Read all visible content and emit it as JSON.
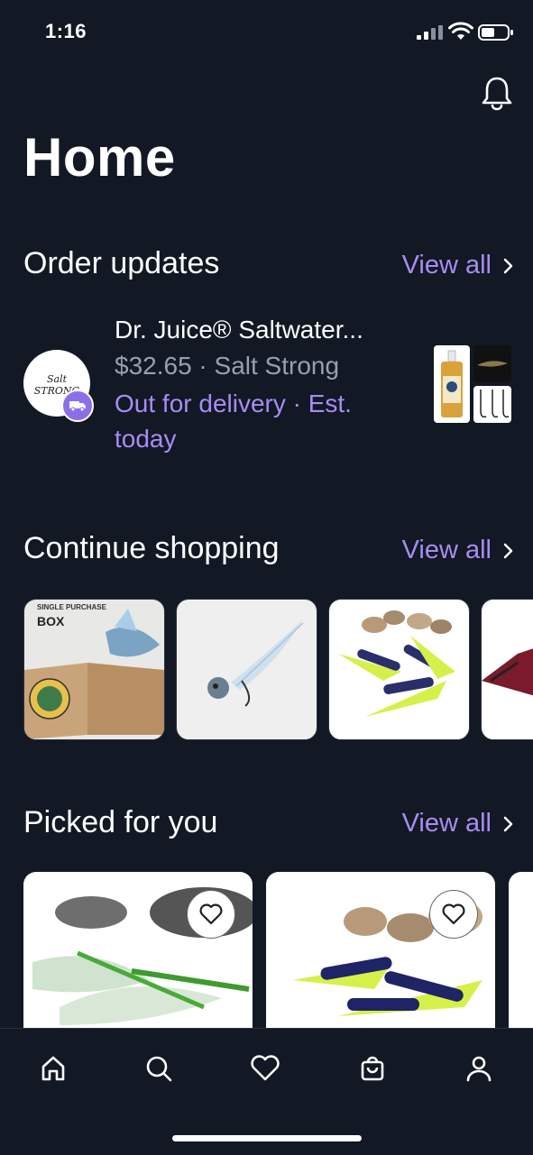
{
  "status_bar": {
    "time": "1:16"
  },
  "page": {
    "title": "Home"
  },
  "order_updates": {
    "title": "Order updates",
    "view_all": "View all",
    "order": {
      "store_logo_text": "Salt STRONG",
      "product_name": "Dr. Juice® Saltwater...",
      "price_store": "$32.65 · Salt Strong",
      "status": "Out for delivery · Est. today"
    }
  },
  "continue_shopping": {
    "title": "Continue shopping",
    "view_all": "View all",
    "items": [
      {
        "label_top": "SINGLE PURCHASE",
        "label_main": "BOX"
      }
    ]
  },
  "picked_for_you": {
    "title": "Picked for you",
    "view_all": "View all"
  },
  "tab_bar": {
    "tabs": [
      "home-icon",
      "search-icon",
      "heart-icon",
      "bag-icon",
      "profile-icon"
    ]
  },
  "colors": {
    "background": "#121824",
    "accent": "#a98cf2",
    "muted": "#9aa0ab"
  }
}
